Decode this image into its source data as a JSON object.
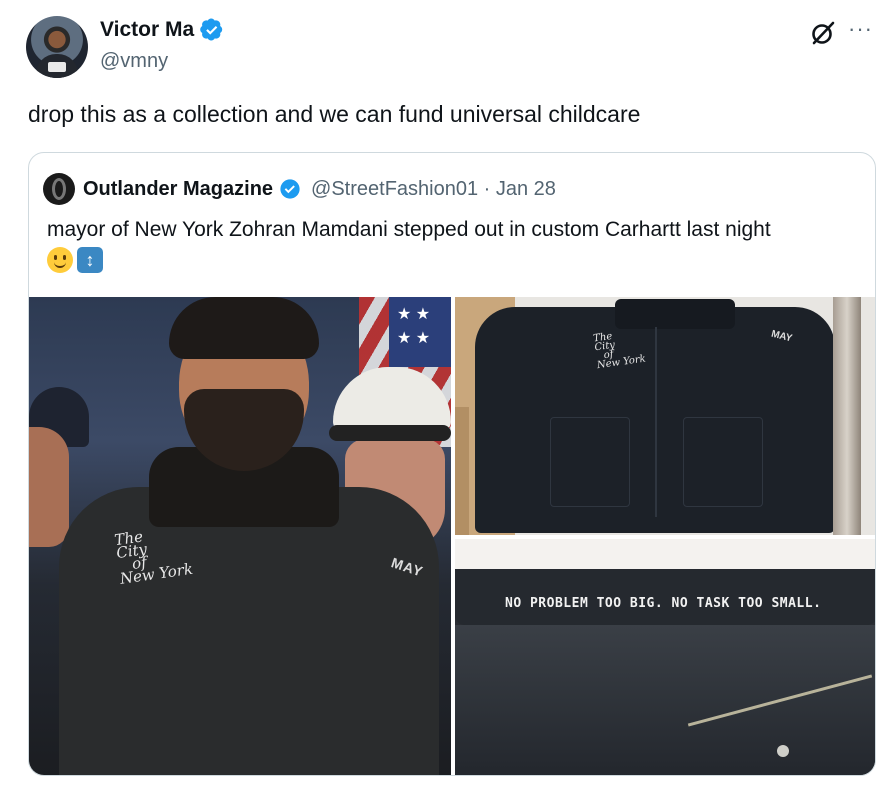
{
  "author": {
    "name": "Victor Ma",
    "handle": "@vmny",
    "verified": true
  },
  "tweet": {
    "text": "drop this as a collection and we can fund universal childcare"
  },
  "actions": {
    "grok_icon": "grok-icon",
    "more_label": "···"
  },
  "quote": {
    "author_name": "Outlander Magazine",
    "verified": true,
    "meta": "@StreetFashion01 · Jan 28",
    "text": "mayor of New York Zohran Mamdani stepped out in custom Carhartt last night",
    "emojis": [
      "slightly-smiling-face",
      "up-down-arrow"
    ],
    "arrows_glyph": "↕"
  },
  "media": {
    "jacket_text_lines": [
      "The",
      "City",
      "of",
      "New York"
    ],
    "jacket_sleeve_text": "MAY",
    "waistband_text": "NO PROBLEM   TOO BIG. NO TASK   TOO SMALL."
  },
  "colors": {
    "verified_blue": "#1d9bf0",
    "text_primary": "#0f1419",
    "text_secondary": "#536471",
    "border": "#cfd9de"
  }
}
